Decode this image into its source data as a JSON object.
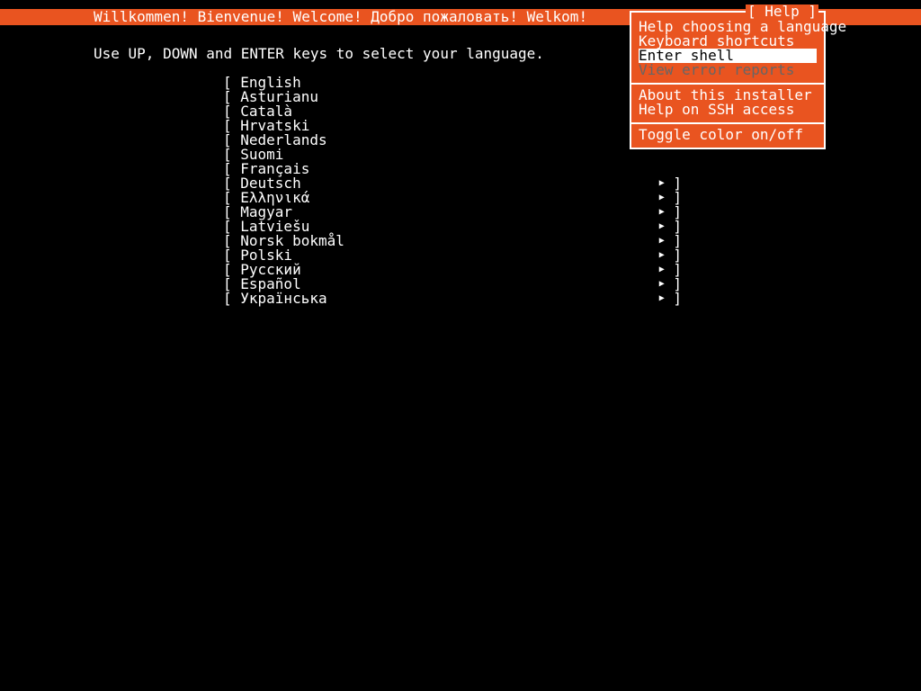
{
  "colors": {
    "accent": "#e95420",
    "bg": "#000000",
    "fg": "#ffffff",
    "muted": "#666666"
  },
  "header": {
    "title": "Willkommen! Bienvenue! Welcome! Добро пожаловать! Welkom!"
  },
  "instruction": "Use UP, DOWN and ENTER keys to select your language.",
  "languages": [
    {
      "label": "English"
    },
    {
      "label": "Asturianu"
    },
    {
      "label": "Català"
    },
    {
      "label": "Hrvatski"
    },
    {
      "label": "Nederlands"
    },
    {
      "label": "Suomi"
    },
    {
      "label": "Français"
    },
    {
      "label": "Deutsch"
    },
    {
      "label": "Ελληνικά"
    },
    {
      "label": "Magyar"
    },
    {
      "label": "Latviešu"
    },
    {
      "label": "Norsk bokmål"
    },
    {
      "label": "Polski"
    },
    {
      "label": "Русский"
    },
    {
      "label": "Español"
    },
    {
      "label": "Українська"
    }
  ],
  "help": {
    "title": "[ Help ]",
    "sections": [
      [
        {
          "label": "Help choosing a language",
          "selected": false,
          "disabled": false
        },
        {
          "label": "Keyboard shortcuts",
          "selected": false,
          "disabled": false
        },
        {
          "label": "Enter shell",
          "selected": true,
          "disabled": false
        },
        {
          "label": "View error reports",
          "selected": false,
          "disabled": true
        }
      ],
      [
        {
          "label": "About this installer",
          "selected": false,
          "disabled": false
        },
        {
          "label": "Help on SSH access",
          "selected": false,
          "disabled": false
        }
      ],
      [
        {
          "label": "Toggle color on/off",
          "selected": false,
          "disabled": false
        }
      ]
    ]
  }
}
